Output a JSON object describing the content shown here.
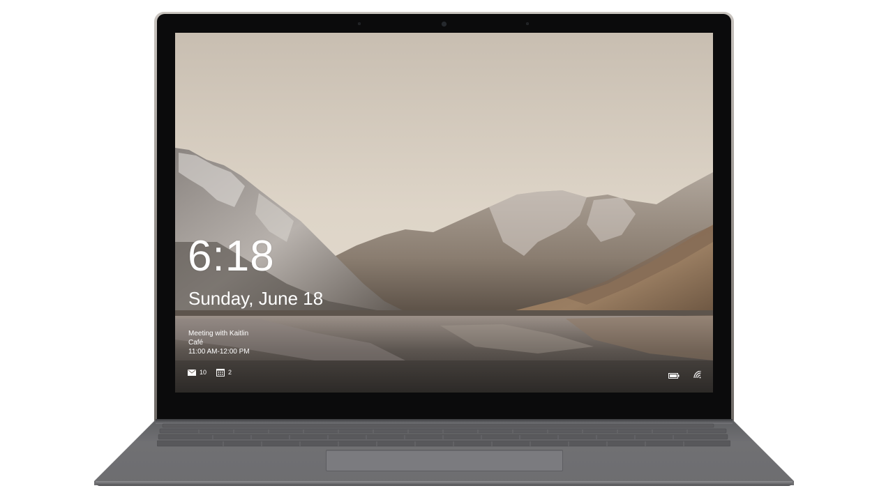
{
  "lock_screen": {
    "time": "6:18",
    "date": "Sunday, June 18",
    "event": {
      "title": "Meeting with Kaitlin",
      "location": "Café",
      "time_range": "11:00 AM-12:00 PM"
    },
    "status": {
      "mail_count": "10",
      "calendar_count": "2"
    },
    "icons": {
      "mail": "mail-icon",
      "calendar": "calendar-icon",
      "battery": "battery-icon",
      "wifi": "wifi-icon"
    }
  }
}
